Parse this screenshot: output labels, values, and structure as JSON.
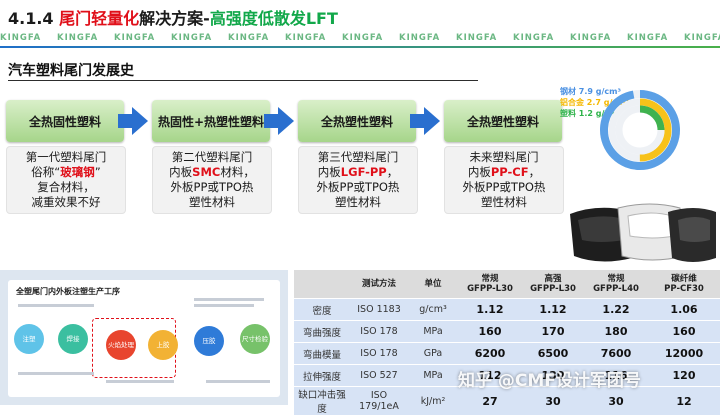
{
  "header": {
    "section": "4.1.4",
    "title_red": "尾门轻量化",
    "title_mid": "解决方案-",
    "title_green": "高强度低散发LFT",
    "watermark": "KINGFA",
    "watermark_count": 13
  },
  "subtitle": "汽车塑料尾门发展史",
  "stages": [
    {
      "label": "全热固性塑料",
      "lines": [
        {
          "t": "第一代塑料尾门"
        },
        {
          "t": "俗称“",
          "hl": "玻璃钢",
          "t2": "”"
        },
        {
          "t": "复合材料，"
        },
        {
          "t": "减重效果不好"
        }
      ]
    },
    {
      "label": "热固性+热塑性塑料",
      "lines": [
        {
          "t": "第二代塑料尾门"
        },
        {
          "t": "内板",
          "hl": "SMC",
          "t2": "材料，"
        },
        {
          "t": "外板PP或TPO热"
        },
        {
          "t": "塑性材料"
        }
      ]
    },
    {
      "label": "全热塑性塑料",
      "lines": [
        {
          "t": "第三代塑料尾门"
        },
        {
          "t": "内板",
          "hl": "LGF-PP",
          "t2": "，"
        },
        {
          "t": "外板PP或TPO热"
        },
        {
          "t": "塑性材料"
        }
      ]
    },
    {
      "label": "全热塑性塑料",
      "lines": [
        {
          "t": "未来塑料尾门"
        },
        {
          "t": "内板",
          "hl": "PP-CF",
          "t2": "，"
        },
        {
          "t": "外板PP或TPO热"
        },
        {
          "t": "塑性材料"
        }
      ]
    }
  ],
  "density_chart": {
    "legend": [
      {
        "label": "钢材 7.9 g/cm³",
        "color": "#4a90e2"
      },
      {
        "label": "铝合金 2.7 g/cm³",
        "color": "#f5b800"
      },
      {
        "label": "塑料 1.2 g/cm³",
        "color": "#2eb34a"
      }
    ],
    "rings": [
      {
        "value": 7.9,
        "color": "#5ba0e6"
      },
      {
        "value": 2.7,
        "color": "#f7c21a"
      },
      {
        "value": 1.2,
        "color": "#3fb24f"
      }
    ]
  },
  "process_image": {
    "title": "全塑尾门内外板注塑生产工序",
    "steps": [
      "注塑",
      "焊接",
      "火焰处理",
      "上胶",
      "压胶",
      "尺寸检验"
    ]
  },
  "table": {
    "headers": [
      "",
      "测试方法",
      "单位",
      "常规\nGFPP-L30",
      "高强\nGFPP-L30",
      "常规\nGFPP-L40",
      "碳纤维\nPP-CF30"
    ],
    "rows": [
      [
        "密度",
        "ISO 1183",
        "g/cm³",
        "1.12",
        "1.12",
        "1.22",
        "1.06"
      ],
      [
        "弯曲强度",
        "ISO 178",
        "MPa",
        "160",
        "170",
        "180",
        "160"
      ],
      [
        "弯曲模量",
        "ISO 178",
        "GPa",
        "6200",
        "6500",
        "7600",
        "12000"
      ],
      [
        "拉伸强度",
        "ISO 527",
        "MPa",
        "112",
        "130",
        "116",
        "120"
      ],
      [
        "缺口冲击强度",
        "ISO 179/1eA",
        "kJ/m²",
        "27",
        "30",
        "30",
        "12"
      ]
    ]
  },
  "watermark_overlay": "知乎 @CMF设计军团号"
}
